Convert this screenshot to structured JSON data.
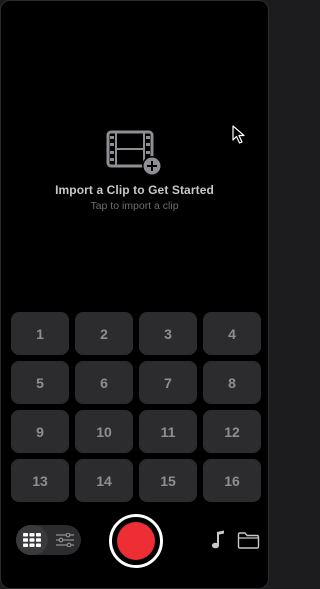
{
  "empty_state": {
    "title": "Import a Clip to Get Started",
    "subtitle": "Tap to import a clip",
    "icon": "film-add-icon"
  },
  "pads": [
    "1",
    "2",
    "3",
    "4",
    "5",
    "6",
    "7",
    "8",
    "9",
    "10",
    "11",
    "12",
    "13",
    "14",
    "15",
    "16"
  ],
  "toolbar": {
    "view_toggle": {
      "options": [
        "grid-icon",
        "sliders-icon"
      ],
      "selected": "grid-icon"
    },
    "record_button": "record-icon",
    "music_button": "music-note-icon",
    "folder_button": "folder-icon"
  },
  "colors": {
    "background": "#000000",
    "pad": "#2c2c2e",
    "pad_text": "#8e8e93",
    "record": "#ee2e35"
  }
}
